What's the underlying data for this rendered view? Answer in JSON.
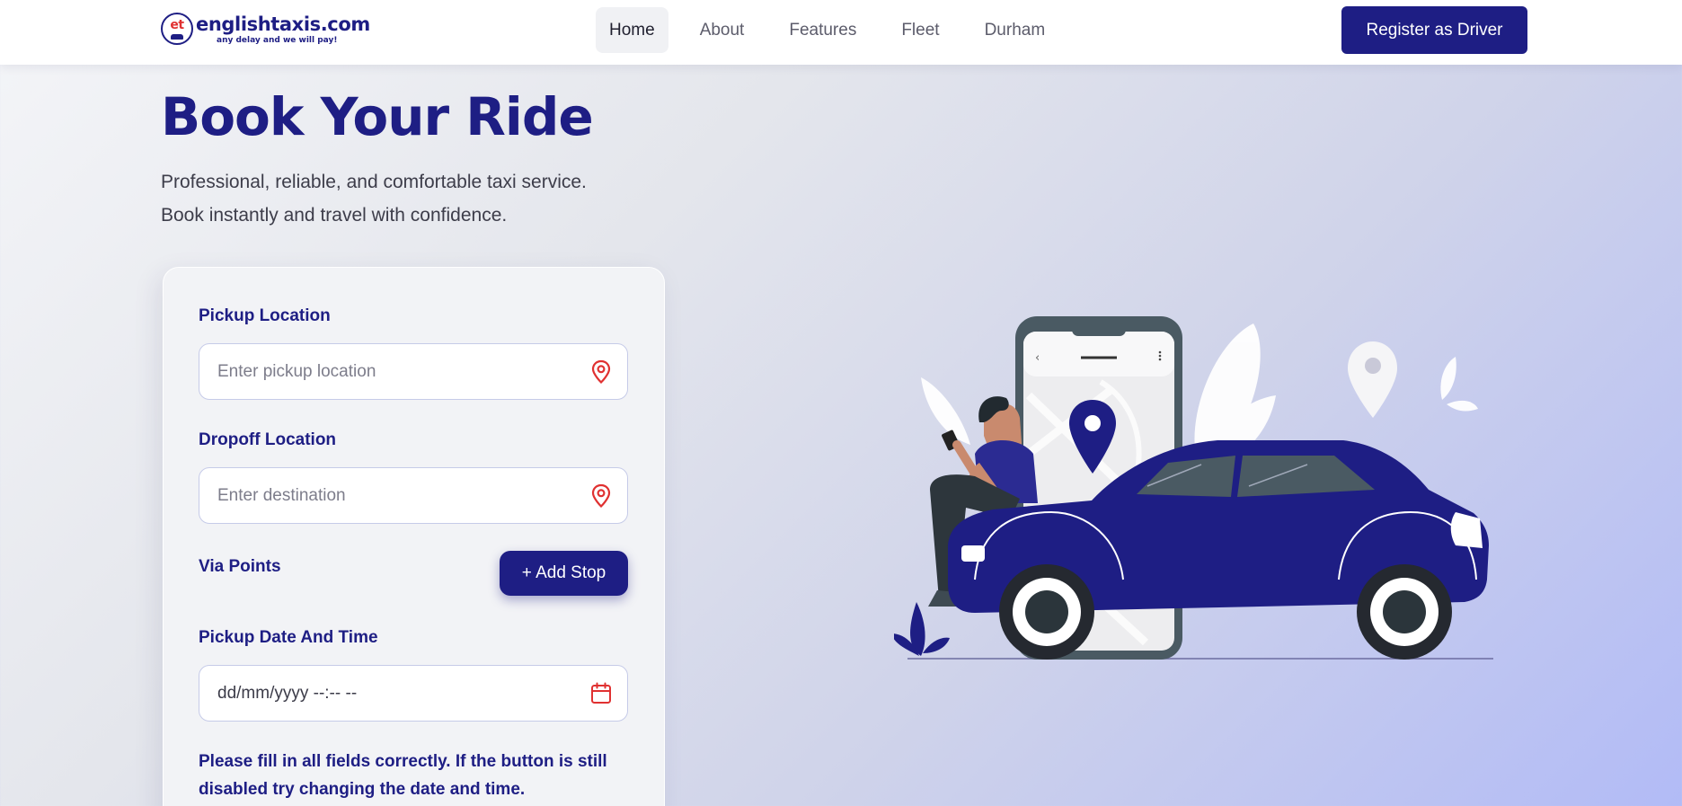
{
  "brand": {
    "badge": "et",
    "name": "englishtaxis.com",
    "tagline": "any delay and we will pay!"
  },
  "nav": {
    "links": [
      {
        "label": "Home",
        "active": true
      },
      {
        "label": "About"
      },
      {
        "label": "Features"
      },
      {
        "label": "Fleet"
      },
      {
        "label": "Durham"
      }
    ],
    "register_label": "Register as Driver"
  },
  "hero": {
    "title": "Book Your Ride",
    "subtitle_line1": "Professional, reliable, and comfortable taxi service.",
    "subtitle_line2": "Book instantly and travel with confidence."
  },
  "form": {
    "pickup": {
      "label": "Pickup Location",
      "placeholder": "Enter pickup location",
      "icon": "location-pin-icon"
    },
    "dropoff": {
      "label": "Dropoff Location",
      "placeholder": "Enter destination",
      "icon": "location-pin-icon"
    },
    "via": {
      "label": "Via Points",
      "add_label": "+ Add Stop"
    },
    "datetime": {
      "label": "Pickup Date And Time",
      "value": "dd/mm/yyyy --:-- --",
      "icon": "calendar-icon"
    },
    "notice": "Please fill in all fields correctly. If the button is still disabled try changing the date and time."
  },
  "colors": {
    "primary": "#1e1e84",
    "icon_red": "#e03131",
    "input_border": "#c6cbe8"
  }
}
